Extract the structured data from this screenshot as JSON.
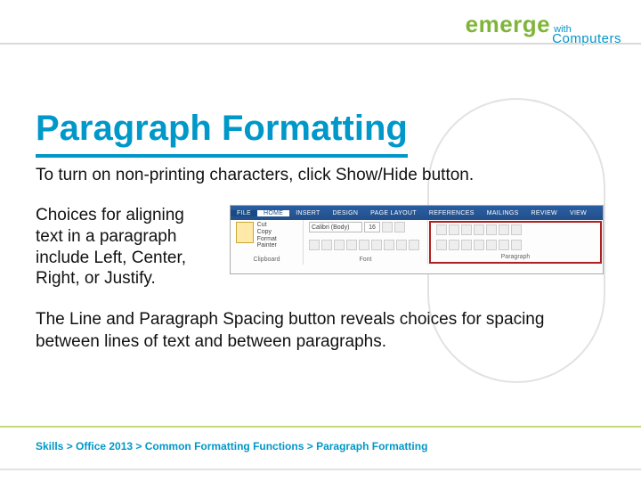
{
  "logo": {
    "main": "emerge",
    "with": "with",
    "sub": "Computers"
  },
  "title": "Paragraph Formatting",
  "body": {
    "p1": "To turn on non-printing characters, click Show/Hide button.",
    "p2": "Choices for aligning text in a paragraph include Left, Center, Right, or Justify.",
    "p3": "The Line and Paragraph Spacing button reveals choices for spacing between lines of text and between paragraphs."
  },
  "ribbon": {
    "tabs": [
      "FILE",
      "HOME",
      "INSERT",
      "DESIGN",
      "PAGE LAYOUT",
      "REFERENCES",
      "MAILINGS",
      "REVIEW",
      "VIEW"
    ],
    "groups": {
      "clipboard": "Clipboard",
      "font": "Font",
      "paragraph": "Paragraph"
    },
    "font_name": "Calibri (Body)",
    "font_size": "16",
    "clip_items": [
      "Cut",
      "Copy",
      "Format Painter"
    ]
  },
  "breadcrumb": "Skills > Office 2013 > Common Formatting Functions > Paragraph Formatting"
}
